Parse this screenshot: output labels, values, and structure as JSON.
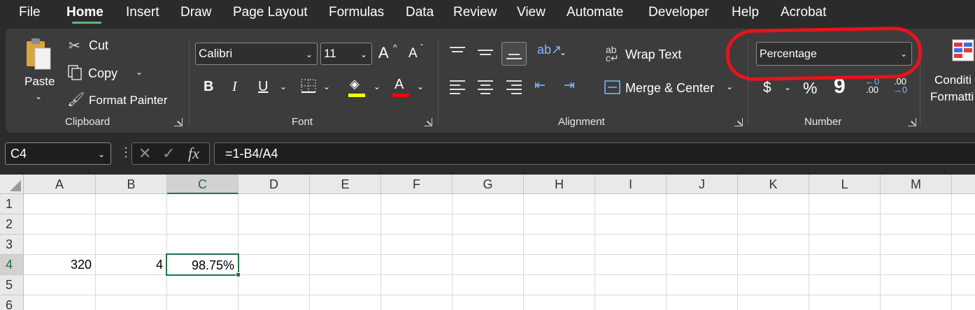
{
  "menu": {
    "tabs": [
      "File",
      "Home",
      "Insert",
      "Draw",
      "Page Layout",
      "Formulas",
      "Data",
      "Review",
      "View",
      "Automate",
      "Developer",
      "Help",
      "Acrobat"
    ],
    "active_tab": "Home"
  },
  "clipboard": {
    "paste": "Paste",
    "cut": "Cut",
    "copy": "Copy",
    "format_painter": "Format Painter",
    "group_label": "Clipboard"
  },
  "font": {
    "family": "Calibri",
    "size": "11",
    "grow": "A",
    "shrink": "A",
    "bold": "B",
    "italic": "I",
    "underline": "U",
    "font_color": "A",
    "group_label": "Font",
    "highlight_color": "#ffff00",
    "text_color": "#ff0000"
  },
  "alignment": {
    "wrap_text": "Wrap Text",
    "merge_center": "Merge & Center",
    "group_label": "Alignment"
  },
  "number": {
    "format": "Percentage",
    "currency": "$",
    "percent": "%",
    "comma": "9",
    "inc_decimal_top": "←0",
    "inc_decimal_bottom": ".00",
    "dec_decimal_top": ".00",
    "dec_decimal_bottom": "→0",
    "group_label": "Number"
  },
  "styles": {
    "conditional_line1": "Conditi",
    "conditional_line2": "Formatti"
  },
  "formula_bar": {
    "name_box": "C4",
    "cancel": "✕",
    "enter": "✓",
    "fx": "fx",
    "formula": "=1-B4/A4"
  },
  "sheet": {
    "columns": [
      "A",
      "B",
      "C",
      "D",
      "E",
      "F",
      "G",
      "H",
      "I",
      "J",
      "K",
      "L",
      "M"
    ],
    "rows": [
      "1",
      "2",
      "3",
      "4",
      "5",
      "6"
    ],
    "cells": {
      "A4": "320",
      "B4": "4",
      "C4": "98.75%"
    },
    "active_cell": "C4"
  },
  "colors": {
    "accent_green": "#217346",
    "annotation_red": "#e5141b",
    "tab_underline": "#5fb878"
  }
}
